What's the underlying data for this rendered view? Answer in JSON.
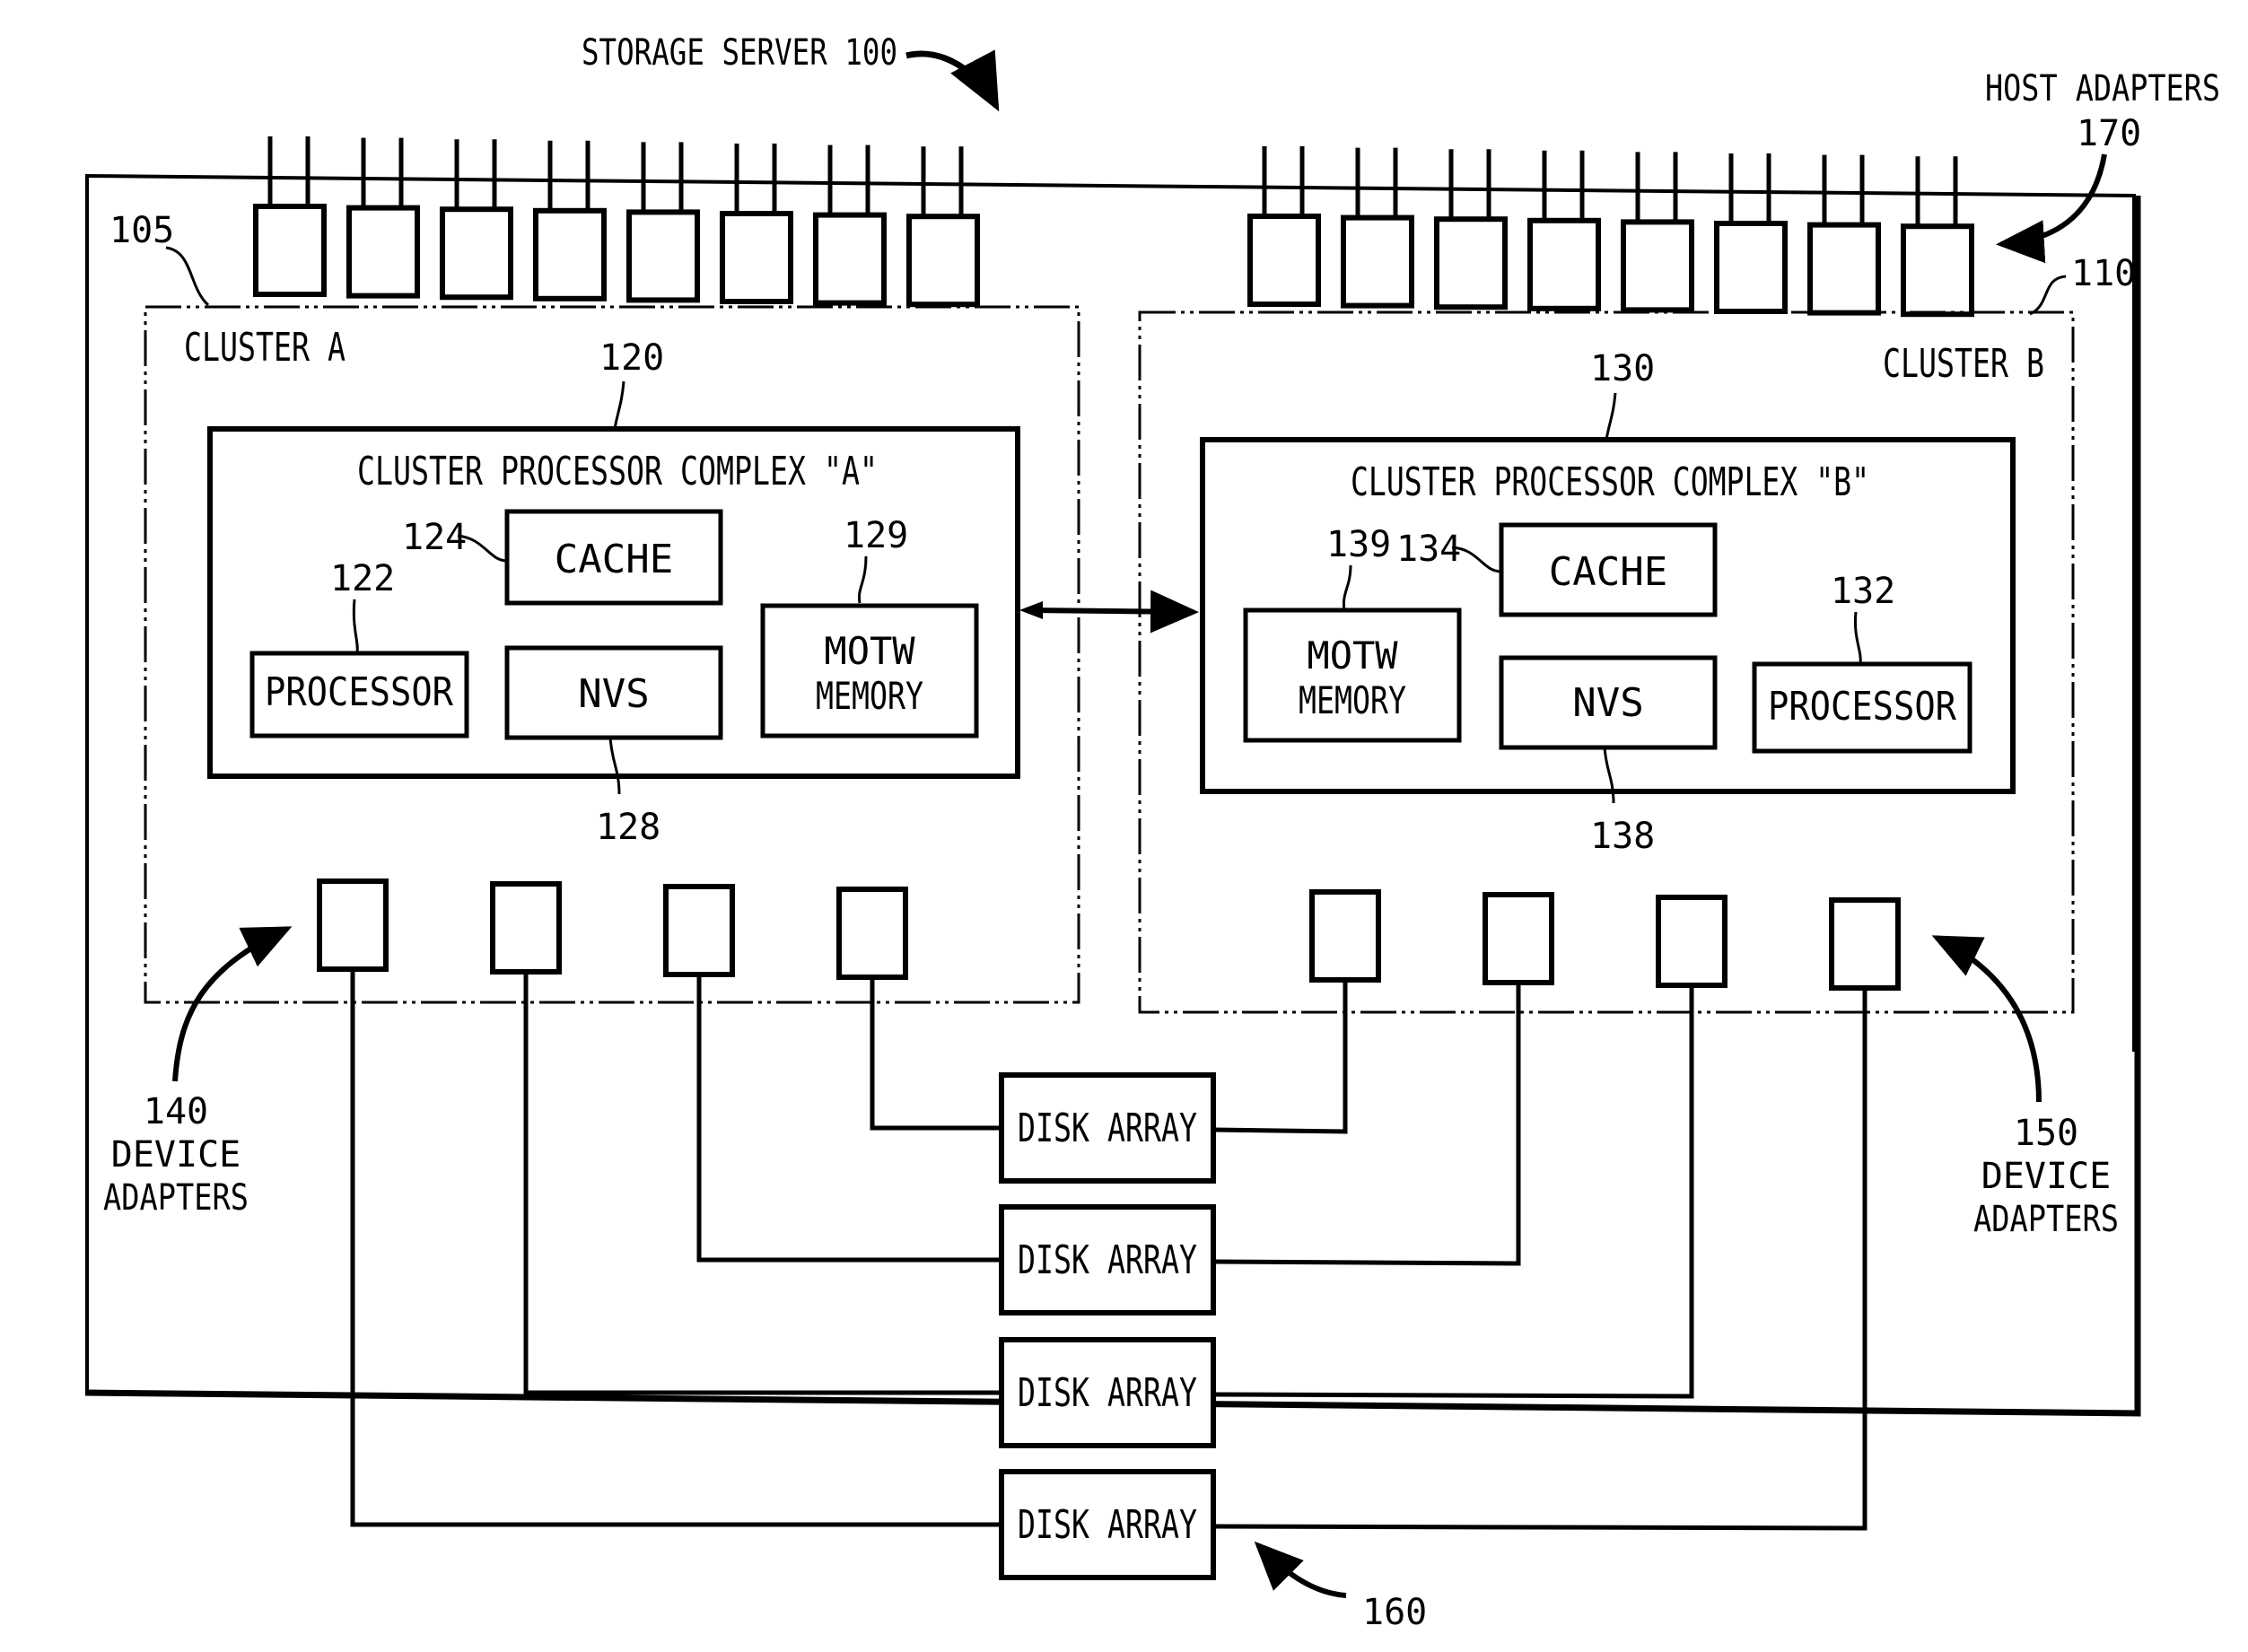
{
  "figure": {
    "title": "STORAGE SERVER 100",
    "host_adapters_label": "HOST ADAPTERS",
    "host_adapters_ref": "170",
    "host_adapter_count_per_side": 8,
    "clusters": [
      {
        "ref": "105",
        "label": "CLUSTER A",
        "complex": {
          "ref": "120",
          "label": "CLUSTER PROCESSOR COMPLEX \"A\"",
          "cache": {
            "ref": "124",
            "label": "CACHE"
          },
          "processor": {
            "ref": "122",
            "label": "PROCESSOR"
          },
          "nvs": {
            "ref": "128",
            "label": "NVS"
          },
          "motw": {
            "ref": "129",
            "label_line1": "MOTW",
            "label_line2": "MEMORY"
          }
        },
        "device_adapters": {
          "ref": "140",
          "label_line1": "DEVICE",
          "label_line2": "ADAPTERS",
          "count": 4
        }
      },
      {
        "ref": "110",
        "label": "CLUSTER B",
        "complex": {
          "ref": "130",
          "label": "CLUSTER PROCESSOR COMPLEX \"B\"",
          "cache": {
            "ref": "134",
            "label": "CACHE"
          },
          "processor": {
            "ref": "132",
            "label": "PROCESSOR"
          },
          "nvs": {
            "ref": "138",
            "label": "NVS"
          },
          "motw": {
            "ref": "139",
            "label_line1": "MOTW",
            "label_line2": "MEMORY"
          }
        },
        "device_adapters": {
          "ref": "150",
          "label_line1": "DEVICE",
          "label_line2": "ADAPTERS",
          "count": 4
        }
      }
    ],
    "disk_arrays": {
      "ref": "160",
      "items": [
        "DISK ARRAY",
        "DISK ARRAY",
        "DISK ARRAY",
        "DISK ARRAY"
      ]
    }
  }
}
